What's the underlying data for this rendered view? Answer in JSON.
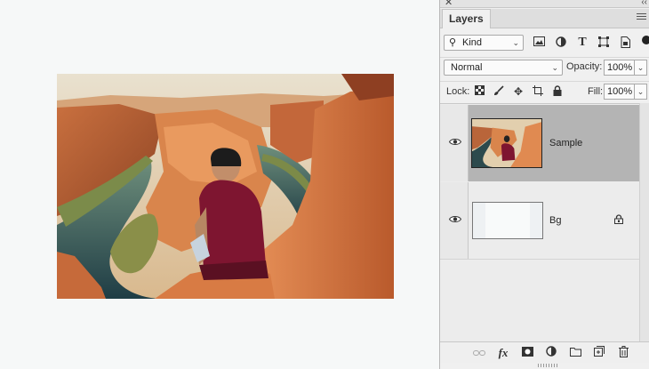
{
  "panel": {
    "title": "Layers",
    "close_icon": "close-icon",
    "collapse_icon": "double-chevron-icon",
    "menu_icon": "hamburger-menu-icon"
  },
  "filter": {
    "kind_label": "Kind",
    "icons": [
      "image-filter-icon",
      "adjustment-filter-icon",
      "type-filter-icon",
      "shape-filter-icon",
      "smart-object-filter-icon"
    ]
  },
  "blend": {
    "mode": "Normal",
    "opacity_label": "Opacity:",
    "opacity_value": "100%"
  },
  "lock": {
    "label": "Lock:",
    "icons": [
      "lock-transparent-pixels-icon",
      "lock-image-pixels-icon",
      "lock-position-icon",
      "lock-artboard-icon",
      "lock-all-icon"
    ],
    "fill_label": "Fill:",
    "fill_value": "100%"
  },
  "layers": [
    {
      "name": "Sample",
      "visible": true,
      "selected": true,
      "locked": false
    },
    {
      "name": "Bg",
      "visible": true,
      "selected": false,
      "locked": true
    }
  ],
  "bottom_bar": {
    "icons": [
      "link-layers-icon",
      "fx-icon",
      "add-mask-icon",
      "adjustment-layer-icon",
      "new-group-icon",
      "new-layer-icon",
      "delete-layer-icon"
    ],
    "fx_label": "fx"
  },
  "colors": {
    "selected_row": "#b4b4b4",
    "panel_bg": "#f0f0f0",
    "canvas_bg": "#f6f8f8"
  }
}
